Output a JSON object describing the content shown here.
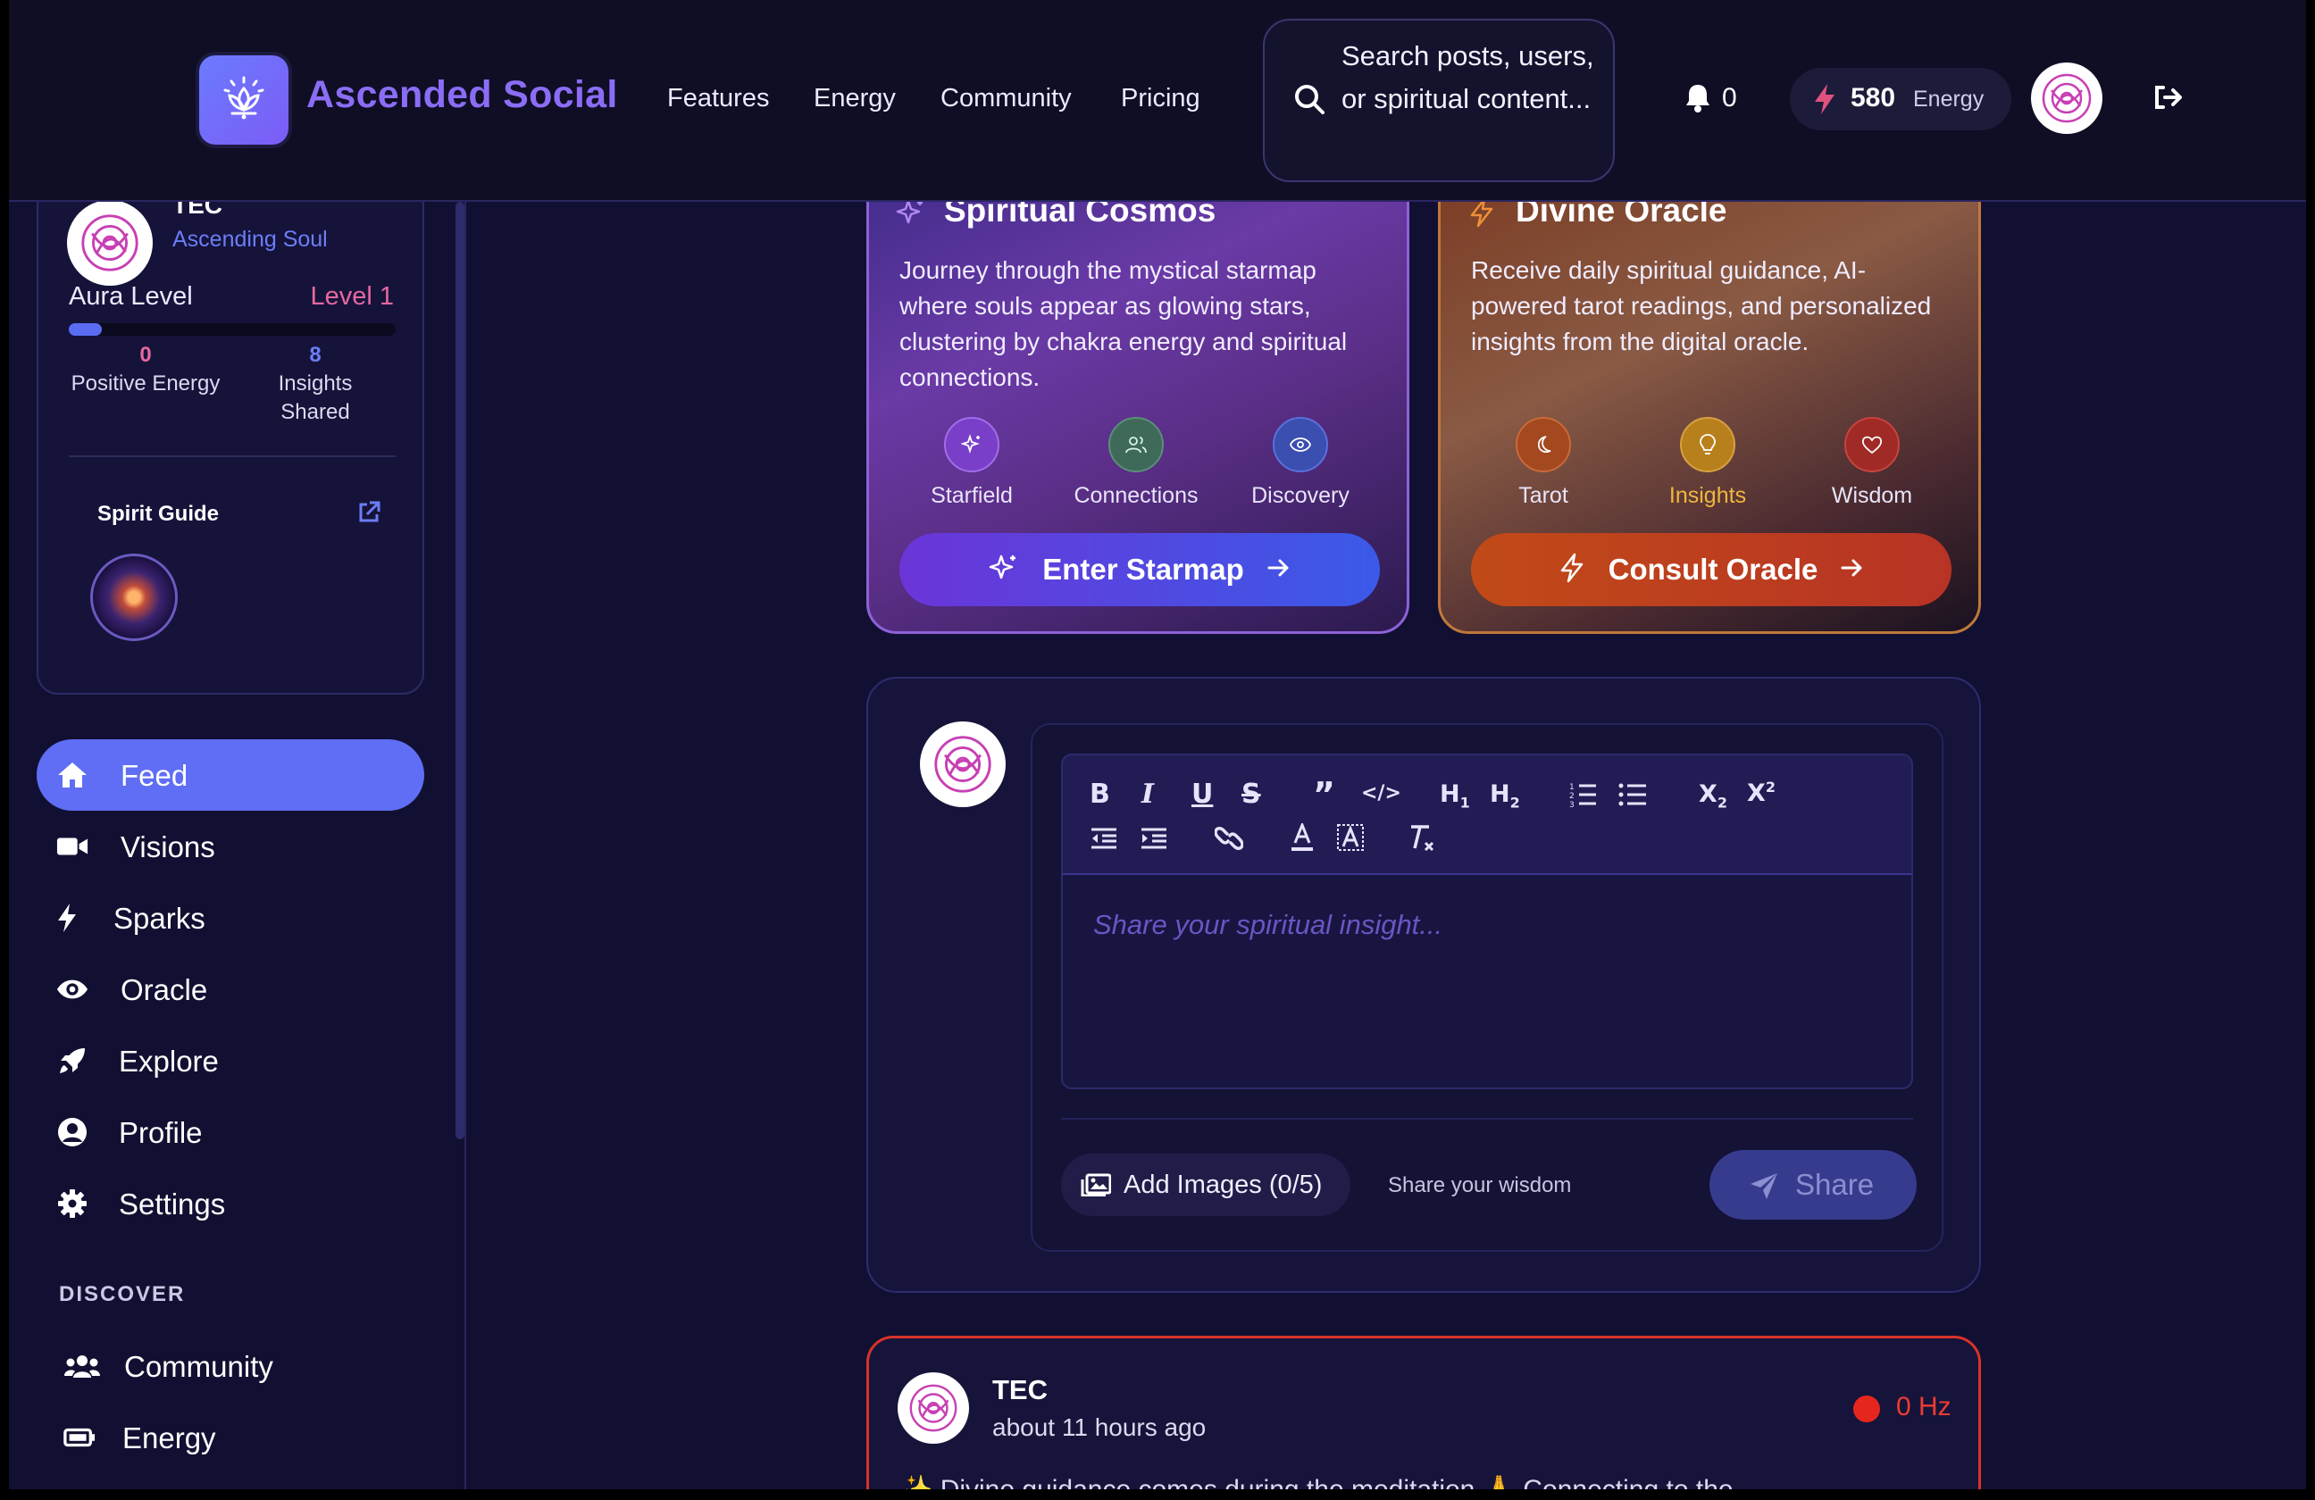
{
  "header": {
    "brand": "Ascended Social",
    "nav": [
      "Features",
      "Energy",
      "Community",
      "Pricing"
    ],
    "search_placeholder": "Search posts, users, or spiritual content...",
    "notification_count": "0",
    "energy_value": "580",
    "energy_label": "Energy"
  },
  "profile": {
    "name": "TEC",
    "rank": "Ascending Soul",
    "aura_label": "Aura Level",
    "aura_level": "Level 1",
    "aura_progress": 0.1,
    "positive_energy_value": "0",
    "positive_energy_label": "Positive Energy",
    "insights_value": "8",
    "insights_label": "Insights Shared",
    "spirit_guide_label": "Spirit Guide"
  },
  "sidebar": {
    "items": [
      {
        "label": "Feed",
        "icon": "home-icon"
      },
      {
        "label": "Visions",
        "icon": "video-icon"
      },
      {
        "label": "Sparks",
        "icon": "bolt-icon"
      },
      {
        "label": "Oracle",
        "icon": "eye-icon"
      },
      {
        "label": "Explore",
        "icon": "rocket-icon"
      },
      {
        "label": "Profile",
        "icon": "user-circle-icon"
      },
      {
        "label": "Settings",
        "icon": "gear-icon"
      }
    ],
    "discover_heading": "DISCOVER",
    "discover_items": [
      {
        "label": "Community",
        "icon": "users-icon"
      },
      {
        "label": "Energy",
        "icon": "battery-icon"
      }
    ]
  },
  "cosmos_card": {
    "title": "Spiritual Cosmos",
    "description": "Journey through the mystical starmap where souls appear as glowing stars, clustering by chakra energy and spiritual connections.",
    "features": [
      "Starfield",
      "Connections",
      "Discovery"
    ],
    "button": "Enter Starmap"
  },
  "oracle_card": {
    "title": "Divine Oracle",
    "description": "Receive daily spiritual guidance, AI-powered tarot readings, and personalized insights from the digital oracle.",
    "features": [
      "Tarot",
      "Insights",
      "Wisdom"
    ],
    "button": "Consult Oracle"
  },
  "composer": {
    "toolbar_row1": [
      "B",
      "I",
      "U",
      "S",
      "”",
      "</>",
      "H1",
      "H2",
      "ol",
      "ul",
      "X2",
      "X2"
    ],
    "placeholder": "Share your spiritual insight...",
    "add_images": "Add Images (0/5)",
    "hint": "Share your wisdom",
    "share": "Share"
  },
  "post": {
    "author": "TEC",
    "time": "about 11 hours ago",
    "frequency": "0 Hz",
    "snippet": "✨ Divine guidance comes during the meditation 🙏 Connecting to the"
  },
  "colors": {
    "accent": "#5f6ef5",
    "brand": "#8b6df5",
    "danger": "#e5261f"
  }
}
